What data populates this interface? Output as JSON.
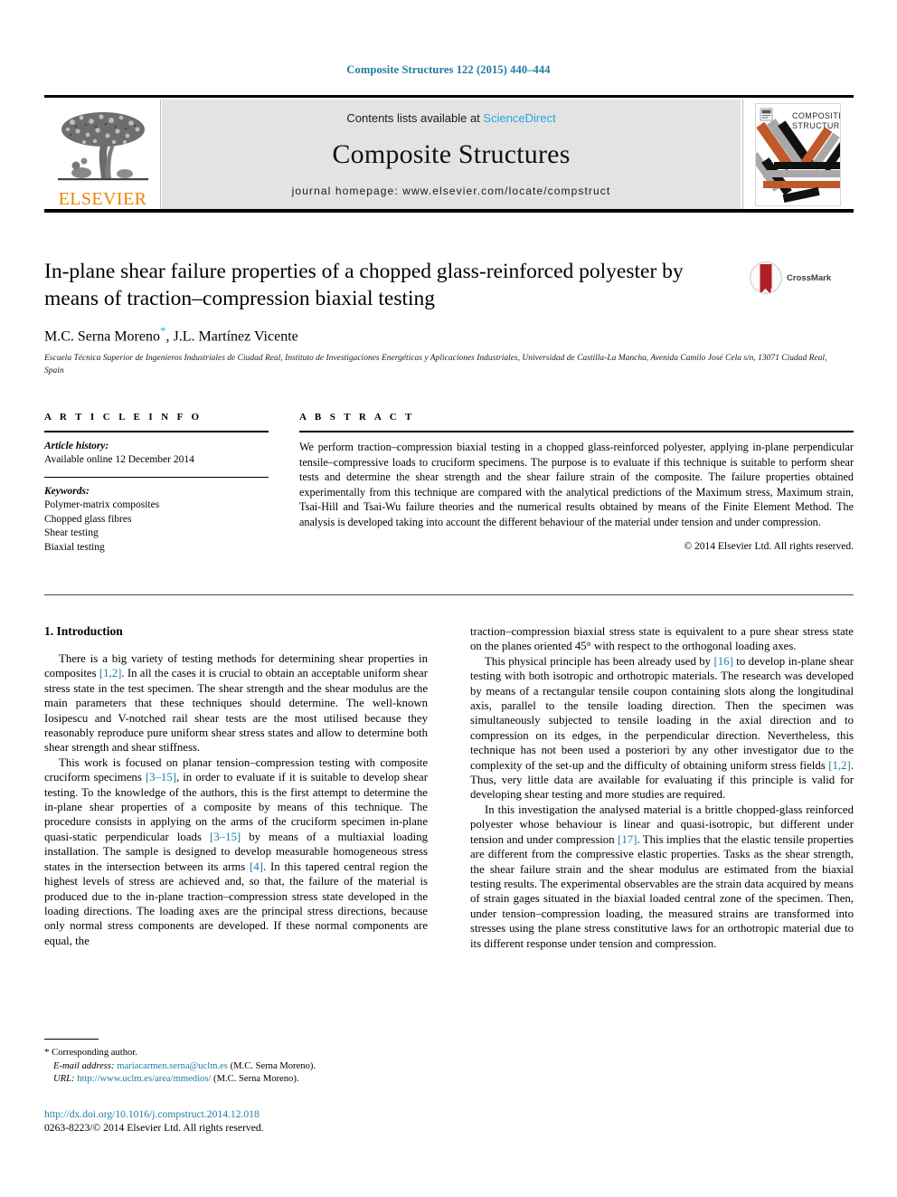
{
  "running_head": "Composite Structures 122 (2015) 440–444",
  "banner": {
    "publisher": "ELSEVIER",
    "contents_prefix": "Contents lists available at ",
    "contents_link": "ScienceDirect",
    "journal_title": "Composite Structures",
    "homepage": "journal homepage: www.elsevier.com/locate/compstruct",
    "cover_line1": "COMPOSITE",
    "cover_line2": "STRUCTURES"
  },
  "article": {
    "title": "In-plane shear failure properties of a chopped glass-reinforced polyester by means of traction–compression biaxial testing",
    "authors": "M.C. Serna Moreno",
    "authors_rest": ", J.L. Martínez Vicente",
    "corresponding_marker": "*",
    "affiliation": "Escuela Técnica Superior de Ingenieros Industriales de Ciudad Real, Instituto de Investigaciones Energéticas y Aplicaciones Industriales, Universidad de Castilla-La Mancha, Avenida Camilo José Cela s/n, 13071 Ciudad Real, Spain",
    "crossmark_label": "CrossMark"
  },
  "info": {
    "heading": "A R T I C L E    I N F O",
    "history_label": "Article history:",
    "history_value": "Available online 12 December 2014",
    "keywords_label": "Keywords:",
    "keywords": [
      "Polymer-matrix composites",
      "Chopped glass fibres",
      "Shear testing",
      "Biaxial testing"
    ]
  },
  "abstract": {
    "heading": "A B S T R A C T",
    "text": "We perform traction–compression biaxial testing in a chopped glass-reinforced polyester, applying in-plane perpendicular tensile–compressive loads to cruciform specimens. The purpose is to evaluate if this technique is suitable to perform shear tests and determine the shear strength and the shear failure strain of the composite. The failure properties obtained experimentally from this technique are compared with the analytical predictions of the Maximum stress, Maximum strain, Tsai-Hill and Tsai-Wu failure theories and the numerical results obtained by means of the Finite Element Method. The analysis is developed taking into account the different behaviour of the material under tension and under compression.",
    "copyright": "© 2014 Elsevier Ltd. All rights reserved."
  },
  "body": {
    "section_title": "1. Introduction",
    "left_paragraphs": [
      "There is a big variety of testing methods for determining shear properties in composites [1,2]. In all the cases it is crucial to obtain an acceptable uniform shear stress state in the test specimen. The shear strength and the shear modulus are the main parameters that these techniques should determine. The well-known Iosipescu and V-notched rail shear tests are the most utilised because they reasonably reproduce pure uniform shear stress states and allow to determine both shear strength and shear stiffness.",
      "This work is focused on planar tension–compression testing with composite cruciform specimens [3–15], in order to evaluate if it is suitable to develop shear testing. To the knowledge of the authors, this is the first attempt to determine the in-plane shear properties of a composite by means of this technique. The procedure consists in applying on the arms of the cruciform specimen in-plane quasi-static perpendicular loads [3–15] by means of a multiaxial loading installation. The sample is designed to develop measurable homogeneous stress states in the intersection between its arms [4]. In this tapered central region the highest levels of stress are achieved and, so that, the failure of the material is produced due to the in-plane traction–compression stress state developed in the loading directions. The loading axes are the principal stress directions, because only normal stress components are developed. If these normal components are equal, the"
    ],
    "right_paragraphs": [
      "traction–compression biaxial stress state is equivalent to a pure shear stress state on the planes oriented 45° with respect to the orthogonal loading axes.",
      "This physical principle has been already used by [16] to develop in-plane shear testing with both isotropic and orthotropic materials. The research was developed by means of a rectangular tensile coupon containing slots along the longitudinal axis, parallel to the tensile loading direction. Then the specimen was simultaneously subjected to tensile loading in the axial direction and to compression on its edges, in the perpendicular direction. Nevertheless, this technique has not been used a posteriori by any other investigator due to the complexity of the set-up and the difficulty of obtaining uniform stress fields [1,2]. Thus, very little data are available for evaluating if this principle is valid for developing shear testing and more studies are required.",
      "In this investigation the analysed material is a brittle chopped-glass reinforced polyester whose behaviour is linear and quasi-isotropic, but different under tension and under compression [17]. This implies that the elastic tensile properties are different from the compressive elastic properties. Tasks as the shear strength, the shear failure strain and the shear modulus are estimated from the biaxial testing results. The experimental observables are the strain data acquired by means of strain gages situated in the biaxial loaded central zone of the specimen. Then, under tension–compression loading, the measured strains are transformed into stresses using the plane stress constitutive laws for an orthotropic material due to its different response under tension and compression."
    ]
  },
  "footnote": {
    "corresponding": "Corresponding author.",
    "email_label": "E-mail address:",
    "email": "mariacarmen.serna@uclm.es",
    "email_suffix": "(M.C. Serna Moreno).",
    "url_label": "URL:",
    "url": "http://www.uclm.es/area/mmedios/",
    "url_suffix": "(M.C. Serna Moreno)."
  },
  "footer": {
    "doi": "http://dx.doi.org/10.1016/j.compstruct.2014.12.018",
    "issn": "0263-8223/© 2014 Elsevier Ltd. All rights reserved."
  },
  "colors": {
    "link_teal": "#1d7ca3",
    "link_blue": "#2ba6de",
    "elsevier_orange": "#ef8200",
    "cover_orange": "#c0592c",
    "cover_grey": "#a8a8a8",
    "banner_grey": "#e3e3e3"
  }
}
